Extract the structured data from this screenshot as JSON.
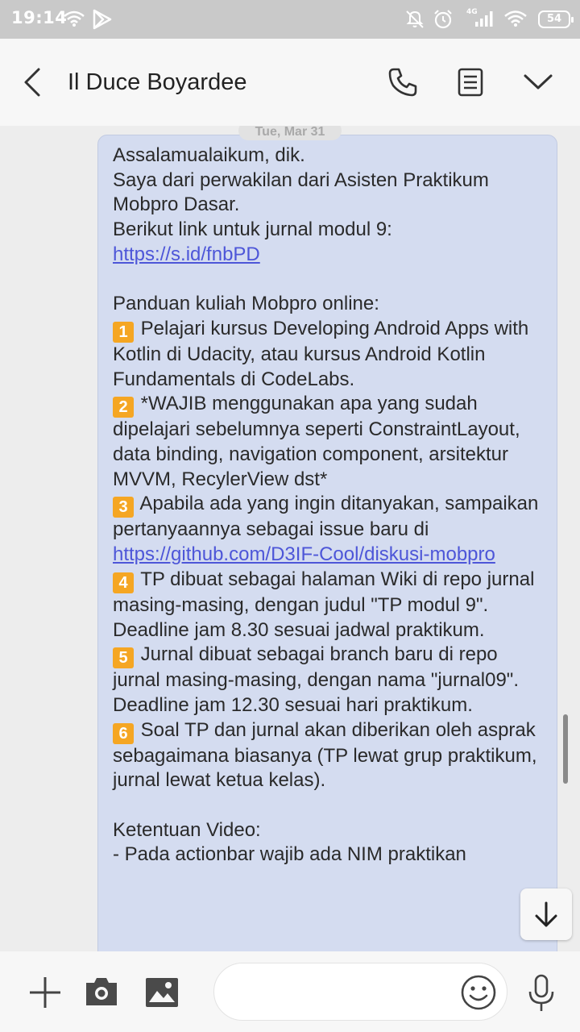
{
  "status_bar": {
    "time": "19:14",
    "network": "4G",
    "battery": "54",
    "icons": [
      "wifi-icon",
      "play-store-icon",
      "mute-icon",
      "alarm-icon",
      "signal-icon",
      "wifi-icon",
      "battery-icon"
    ]
  },
  "header": {
    "title": "Il Duce Boyardee",
    "icons": [
      "back-arrow-icon",
      "phone-icon",
      "details-icon",
      "chevron-down-icon"
    ]
  },
  "conversation": {
    "date": "Tue, Mar 31",
    "message": {
      "greeting": "Assalamualaikum, dik.",
      "intro": "Saya dari perwakilan dari Asisten Praktikum Mobpro Dasar.",
      "link_intro": "Berikut link untuk jurnal modul 9:",
      "link1": "https://s.id/fnbPD",
      "panduan_title": "Panduan kuliah Mobpro online:",
      "items": [
        {
          "num": "1",
          "text": "Pelajari kursus Developing Android Apps with Kotlin di Udacity, atau kursus Android Kotlin Fundamentals di CodeLabs."
        },
        {
          "num": "2",
          "text": "*WAJIB menggunakan apa yang sudah dipelajari sebelumnya seperti ConstraintLayout, data binding, navigation component, arsitektur MVVM, RecylerView dst*"
        },
        {
          "num": "3",
          "text": "Apabila ada yang ingin ditanyakan, sampaikan pertanyaannya sebagai issue baru di ",
          "link": "https://github.com/D3IF-Cool/diskusi-mobpro"
        },
        {
          "num": "4",
          "text": "TP dibuat sebagai halaman Wiki di repo jurnal masing-masing, dengan judul \"TP modul 9\". Deadline jam 8.30 sesuai jadwal praktikum."
        },
        {
          "num": "5",
          "text": "Jurnal dibuat sebagai branch baru di repo jurnal masing-masing, dengan nama \"jurnal09\". Deadline jam 12.30 sesuai hari praktikum."
        },
        {
          "num": "6",
          "text": "Soal TP dan jurnal akan diberikan oleh asprak sebagaimana biasanya (TP lewat grup praktikum, jurnal lewat ketua kelas)."
        }
      ],
      "video_title": "Ketentuan Video:",
      "video_first": "- Pada actionbar wajib ada NIM praktikan"
    }
  },
  "composer": {
    "placeholder": "",
    "icons": [
      "plus-icon",
      "camera-icon",
      "gallery-icon",
      "emoji-icon",
      "microphone-icon"
    ]
  },
  "colors": {
    "bubble": "#d4dcf0",
    "link": "#4d56d8",
    "number_badge": "#f5a623",
    "status_bar": "#c9c9c9"
  }
}
